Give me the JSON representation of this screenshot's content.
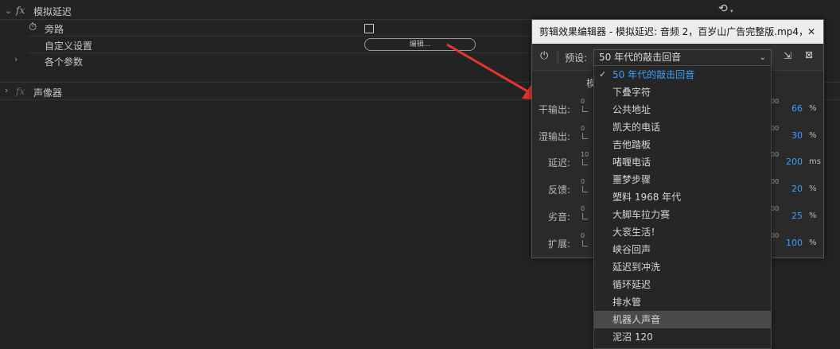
{
  "effects_panel": {
    "effect1_name": "模拟延迟",
    "bypass_label": "旁路",
    "custom_setup_label": "自定义设置",
    "edit_button_label": "编辑...",
    "params_label": "各个参数",
    "effect2_name": "声像器",
    "fx_label": "fx",
    "reset_icon": "reset-icon"
  },
  "dialog": {
    "title": "剪辑效果编辑器 - 模拟延迟: 音频 2，百岁山广告完整版.mp4，...",
    "close_label": "✕",
    "preset_label": "预设:",
    "preset_value": "50 年代的敲击回音",
    "mode_label": "模",
    "params": [
      {
        "label": "干输出:",
        "min": "0",
        "max": "00",
        "value": "66",
        "unit": "%"
      },
      {
        "label": "湿输出:",
        "min": "0",
        "max": "00",
        "value": "30",
        "unit": "%"
      },
      {
        "label": "延迟:",
        "min": "10",
        "max": "00",
        "value": "200",
        "unit": "ms"
      },
      {
        "label": "反馈:",
        "min": "0",
        "max": "00",
        "value": "20",
        "unit": "%"
      },
      {
        "label": "劣音:",
        "min": "0",
        "max": "00",
        "value": "25",
        "unit": "%"
      },
      {
        "label": "扩展:",
        "min": "0",
        "max": "00",
        "value": "100",
        "unit": "%"
      }
    ]
  },
  "preset_options": [
    "50 年代的敲击回音",
    "下叠字符",
    "公共地址",
    "凯夫的电话",
    "吉他踏板",
    "啫喱电话",
    "噩梦步骤",
    "塑料 1968 年代",
    "大脚车拉力赛",
    "大衮生活！",
    "峡谷回声",
    "延迟到冲洗",
    "循环延迟",
    "排水管",
    "机器人声音",
    "泥沼 120"
  ],
  "colors": {
    "accent": "#3aa0ff",
    "arrow": "#e8362b",
    "background": "#232323"
  }
}
